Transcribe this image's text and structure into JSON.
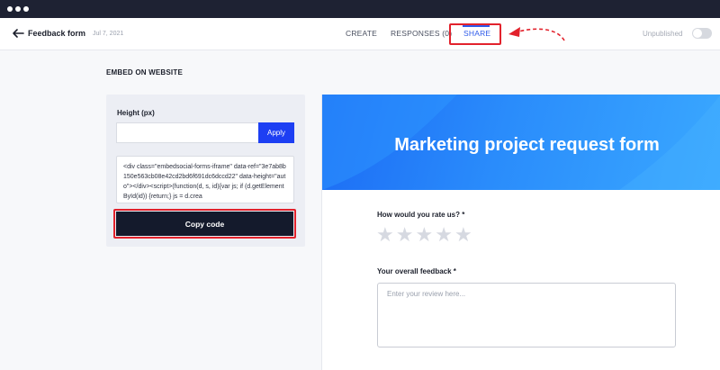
{
  "header": {
    "form_name": "Feedback form",
    "date": "Jul 7, 2021",
    "tabs": [
      {
        "label": "CREATE",
        "active": false
      },
      {
        "label": "RESPONSES (0)",
        "active": false
      },
      {
        "label": "SHARE",
        "active": true
      }
    ],
    "status": "Unpublished",
    "published": false
  },
  "embed": {
    "section_title": "EMBED ON WEBSITE",
    "height_label": "Height (px)",
    "height_value": "",
    "apply_label": "Apply",
    "code": "<div class=\"embedsocial-forms-iframe\" data-ref=\"3e7ab8b150e563cb08e42cd2bd6f691dc6dccd22\" data-height=\"auto\"></div><script>(function(d, s, id){var js; if (d.getElementById(id)) {return;} js = d.crea",
    "copy_label": "Copy code"
  },
  "preview": {
    "title": "Marketing project request form",
    "rating_question": "How would you rate us? *",
    "rating_max": 5,
    "rating_value": 0,
    "feedback_question": "Your overall feedback *",
    "feedback_placeholder": "Enter your review here..."
  },
  "colors": {
    "accent": "#2f5bea",
    "apply_button": "#1d3ff3",
    "copy_button": "#141a2c",
    "highlight": "#e2222c",
    "banner": "#2a8cfb"
  }
}
